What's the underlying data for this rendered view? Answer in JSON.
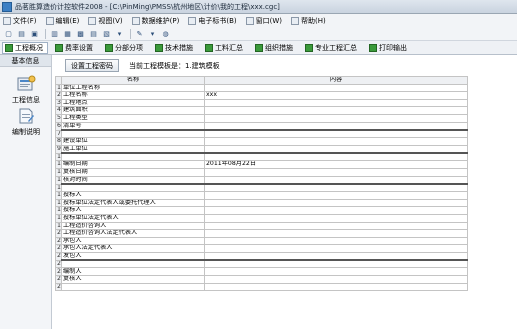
{
  "window": {
    "title": "品茗胜算造价计控软件2008 - [C:\\PinMing\\PMSS\\杭州地区\\计价\\我的工程\\xxx.cgc]"
  },
  "menu": [
    {
      "label": "文件(F)"
    },
    {
      "label": "编辑(E)"
    },
    {
      "label": "视图(V)"
    },
    {
      "label": "数据维护(P)"
    },
    {
      "label": "电子标书(B)"
    },
    {
      "label": "窗口(W)"
    },
    {
      "label": "帮助(H)"
    }
  ],
  "toolbar_icons": [
    "new-icon",
    "open-icon",
    "save-icon",
    "print-icon",
    "preview-icon",
    "grid-icon",
    "list-icon",
    "calc-icon",
    "dropdown-icon",
    "settings-icon",
    "dropdown-icon",
    "globe-icon"
  ],
  "tabs": [
    {
      "label": "工程概况",
      "active": true
    },
    {
      "label": "费率设置"
    },
    {
      "label": "分部分项"
    },
    {
      "label": "技术措施"
    },
    {
      "label": "工料汇总"
    },
    {
      "label": "组织措施"
    },
    {
      "label": "专业工程汇总"
    },
    {
      "label": "打印输出"
    }
  ],
  "sidebar": {
    "header": "基本信息",
    "items": [
      {
        "label": "工程信息"
      },
      {
        "label": "编制说明"
      }
    ]
  },
  "content": {
    "set_password_label": "设置工程密码",
    "template_text": "当前工程模板是：1.建筑模板",
    "columns": {
      "name": "名称",
      "value": "内容"
    },
    "rows": [
      {
        "num": "1",
        "name": "单位工程名称",
        "value": ""
      },
      {
        "num": "2",
        "name": "工程名称",
        "value": "xxx"
      },
      {
        "num": "3",
        "name": "工程地点",
        "value": ""
      },
      {
        "num": "4",
        "name": "建筑面积",
        "value": ""
      },
      {
        "num": "5",
        "name": "工程类型",
        "value": ""
      },
      {
        "num": "6",
        "name": "清单号",
        "value": ""
      },
      {
        "num": "7",
        "name": "",
        "value": ""
      },
      {
        "num": "8",
        "name": "建设单位",
        "value": ""
      },
      {
        "num": "9",
        "name": "施工单位",
        "value": ""
      },
      {
        "num": "10",
        "name": "",
        "value": ""
      },
      {
        "num": "11",
        "name": "编制日期",
        "value": "2011年08月22日"
      },
      {
        "num": "12",
        "name": "复核日期",
        "value": ""
      },
      {
        "num": "13",
        "name": "核对时间",
        "value": ""
      },
      {
        "num": "14",
        "name": "",
        "value": ""
      },
      {
        "num": "15",
        "name": "投标人",
        "value": ""
      },
      {
        "num": "16",
        "name": "投标单位法定代表人或委托代理人",
        "value": ""
      },
      {
        "num": "17",
        "name": "投标人",
        "value": ""
      },
      {
        "num": "18",
        "name": "投标单位法定代表人",
        "value": ""
      },
      {
        "num": "19",
        "name": "工程造价咨询人",
        "value": ""
      },
      {
        "num": "20",
        "name": "工程造价咨询人法定代表人",
        "value": ""
      },
      {
        "num": "21",
        "name": "承包人",
        "value": ""
      },
      {
        "num": "22",
        "name": "承包人法定代表人",
        "value": ""
      },
      {
        "num": "23",
        "name": "发包人",
        "value": ""
      },
      {
        "num": "24",
        "name": "",
        "value": ""
      },
      {
        "num": "25",
        "name": "编制人",
        "value": ""
      },
      {
        "num": "26",
        "name": "复核人",
        "value": ""
      },
      {
        "num": "27",
        "name": "",
        "value": ""
      }
    ],
    "separator_rows": [
      "7",
      "10",
      "14",
      "24"
    ]
  }
}
